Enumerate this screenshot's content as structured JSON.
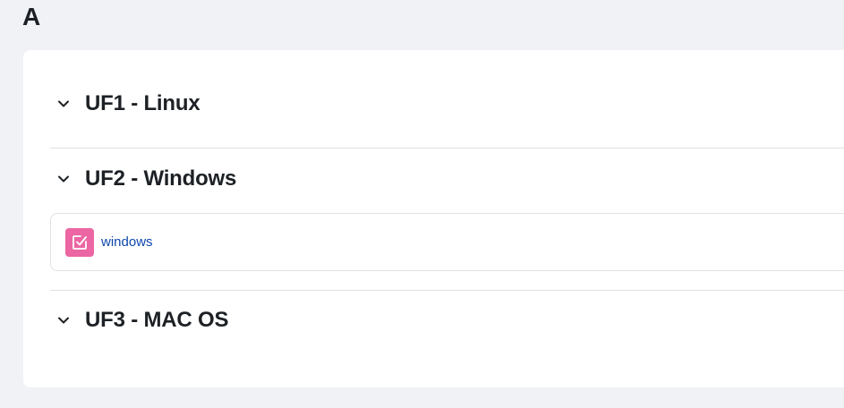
{
  "page": {
    "heading": "A"
  },
  "sections": [
    {
      "title": "UF1 - Linux",
      "expanded": true,
      "activities": []
    },
    {
      "title": "UF2 - Windows",
      "expanded": true,
      "activities": [
        {
          "name": "windows",
          "icon": "assignment-icon",
          "icon_color": "#eb66a2"
        }
      ]
    },
    {
      "title": "UF3 - MAC OS",
      "expanded": true,
      "activities": []
    }
  ],
  "colors": {
    "background": "#f1f2f6",
    "card": "#ffffff",
    "link": "#0f47ad",
    "divider": "#dee2e6"
  }
}
